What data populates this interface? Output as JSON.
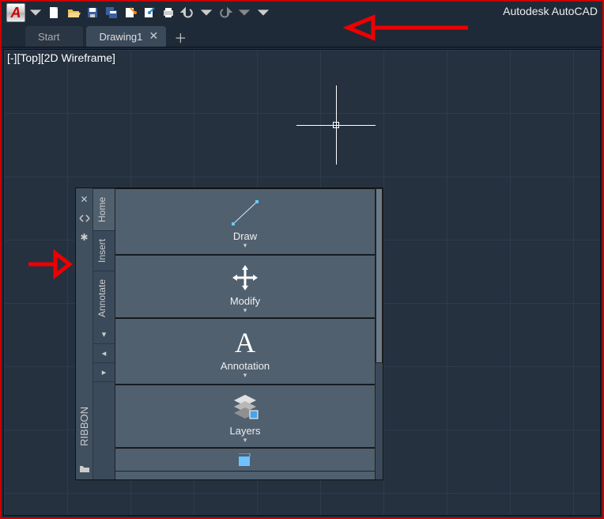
{
  "app": {
    "title": "Autodesk AutoCAD",
    "logo_text": "A"
  },
  "qat": [
    "new",
    "open",
    "save",
    "saveas",
    "open-web",
    "plot-cloud",
    "plot",
    "undo",
    "redo"
  ],
  "tabs": {
    "items": [
      {
        "label": "Start",
        "active": false,
        "closable": false
      },
      {
        "label": "Drawing1",
        "active": true,
        "closable": true
      }
    ]
  },
  "viewport": {
    "label": "[-][Top][2D Wireframe]"
  },
  "palette": {
    "title": "RIBBON",
    "ctrl_icons": [
      "close",
      "dock",
      "settings"
    ],
    "bottom_icon": "folder",
    "tabs": [
      {
        "label": "Home",
        "active": true
      },
      {
        "label": "Insert",
        "active": false
      },
      {
        "label": "Annotate",
        "active": false
      }
    ],
    "extra_tabs": [
      "▾",
      "◂",
      "▸"
    ],
    "panels": [
      {
        "title": "Draw",
        "icon": "line"
      },
      {
        "title": "Modify",
        "icon": "move"
      },
      {
        "title": "Annotation",
        "icon": "A"
      },
      {
        "title": "Layers",
        "icon": "layers"
      },
      {
        "title": "",
        "icon": "block"
      }
    ]
  }
}
